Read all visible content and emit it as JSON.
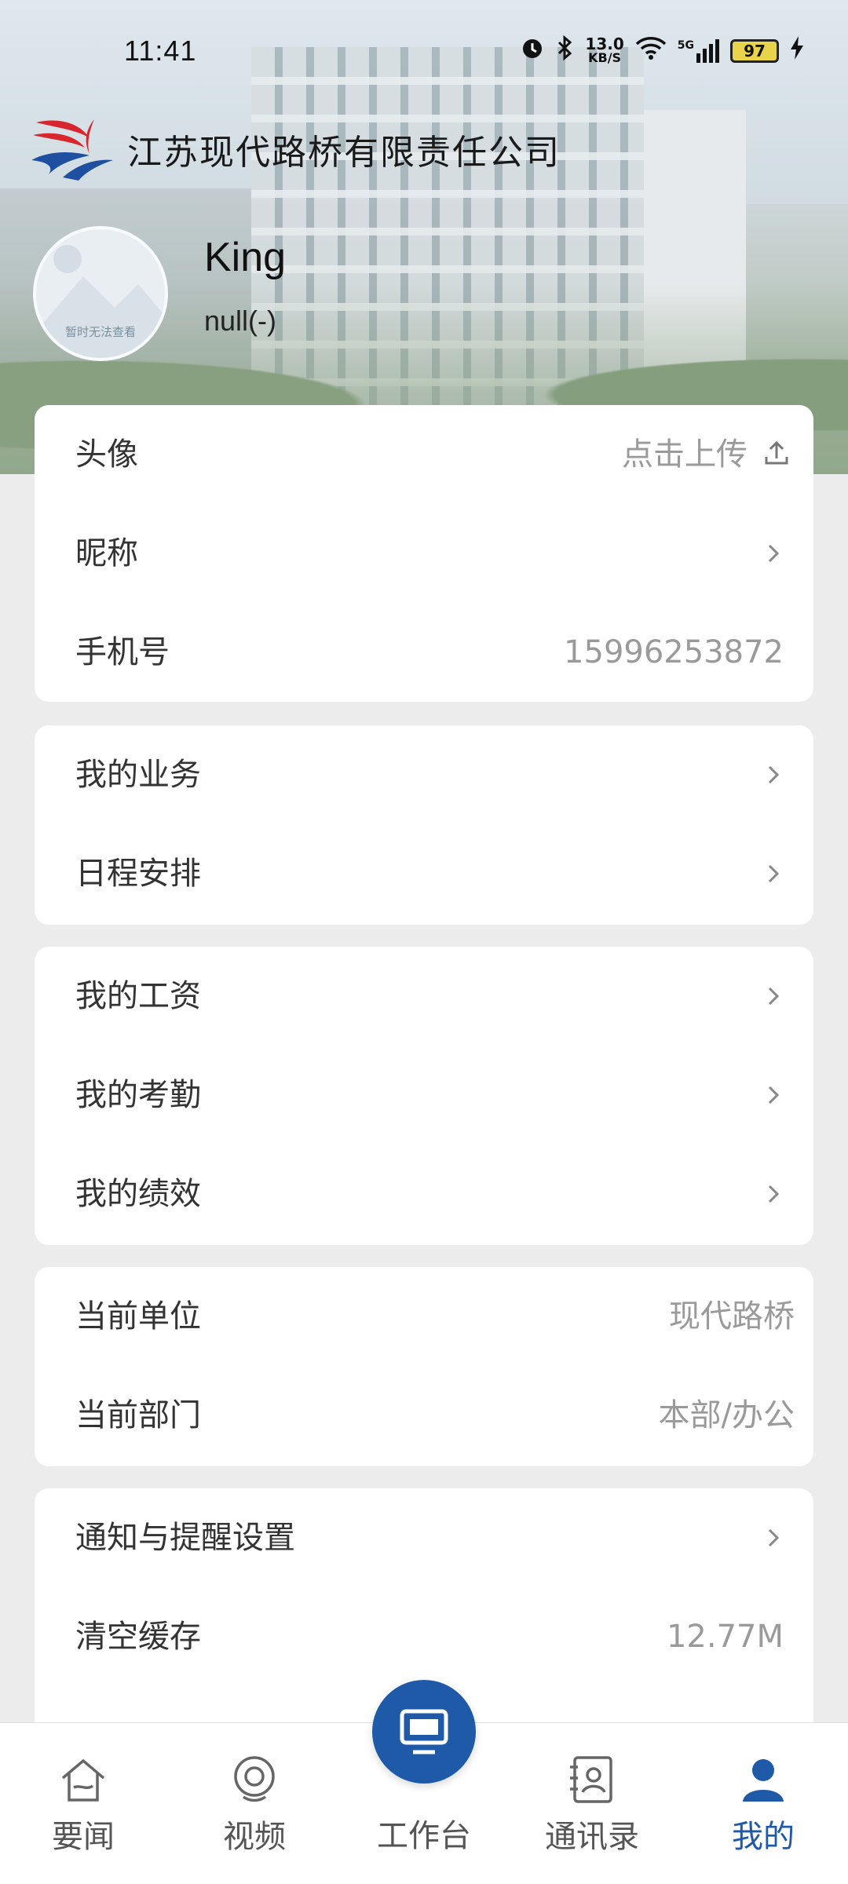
{
  "status_bar": {
    "time": "11:41",
    "net_speed_value": "13.0",
    "net_speed_unit": "KB/S",
    "signal_label": "5G",
    "battery": "97"
  },
  "header": {
    "company_name": "江苏现代路桥有限责任公司"
  },
  "profile": {
    "avatar_caption": "暂时无法查看",
    "name": "King",
    "subtitle": "null(-)"
  },
  "account_card": {
    "avatar_label": "头像",
    "avatar_action": "点击上传",
    "nickname_label": "昵称",
    "phone_label": "手机号",
    "phone_value": "15996253872"
  },
  "business_card": {
    "business_label": "我的业务",
    "schedule_label": "日程安排"
  },
  "hr_card": {
    "salary_label": "我的工资",
    "attendance_label": "我的考勤",
    "performance_label": "我的绩效"
  },
  "org_card": {
    "unit_label": "当前单位",
    "unit_value": "现代路桥",
    "dept_label": "当前部门",
    "dept_value": "本部/办公"
  },
  "settings_card": {
    "notify_label": "通知与提醒设置",
    "cache_label": "清空缓存",
    "cache_value": "12.77M"
  },
  "tabbar": {
    "news": "要闻",
    "video": "视频",
    "workbench": "工作台",
    "contacts": "通讯录",
    "mine": "我的",
    "active_color": "#1e5aa8",
    "inactive_color": "#555555"
  }
}
